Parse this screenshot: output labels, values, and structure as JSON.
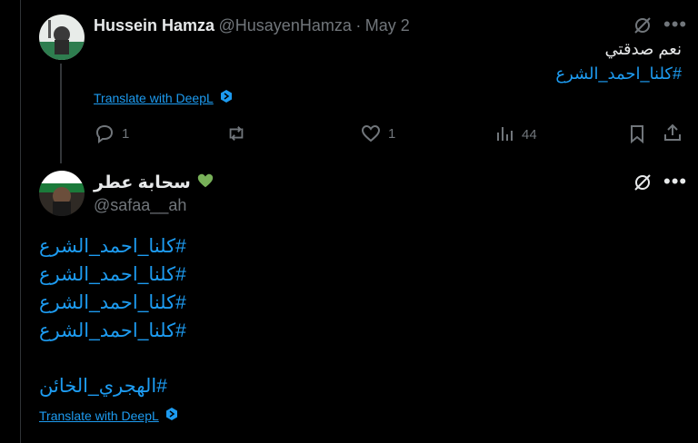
{
  "tweet1": {
    "display_name": "Hussein Hamza",
    "handle": "@HusayenHamza",
    "separator": "·",
    "date": "May 2",
    "text": "نعم صدقتي",
    "hashtag": "#كلنا_احمد_الشرع",
    "translate_label": "Translate with DeepL",
    "actions": {
      "reply_count": "1",
      "repost_count": "",
      "like_count": "1",
      "views_count": "44"
    }
  },
  "tweet2": {
    "display_name": "سحابة عطر",
    "handle": "@safaa__ah",
    "hashtags": [
      "#كلنا_احمد_الشرع",
      "#كلنا_احمد_الشرع",
      "#كلنا_احمد_الشرع",
      "#كلنا_احمد_الشرع"
    ],
    "last_hashtag": "#الهجري_الخائن",
    "translate_label": "Translate with DeepL"
  },
  "colors": {
    "background": "#000000",
    "text": "#e7e9ea",
    "secondary": "#71767b",
    "accent": "#1d9bf0",
    "heart_emoji": "#78b159"
  },
  "icons": [
    "grok-icon",
    "more-icon",
    "reply-icon",
    "repost-icon",
    "like-icon",
    "views-icon",
    "bookmark-icon",
    "share-icon",
    "green-heart-icon",
    "deepl-icon"
  ]
}
